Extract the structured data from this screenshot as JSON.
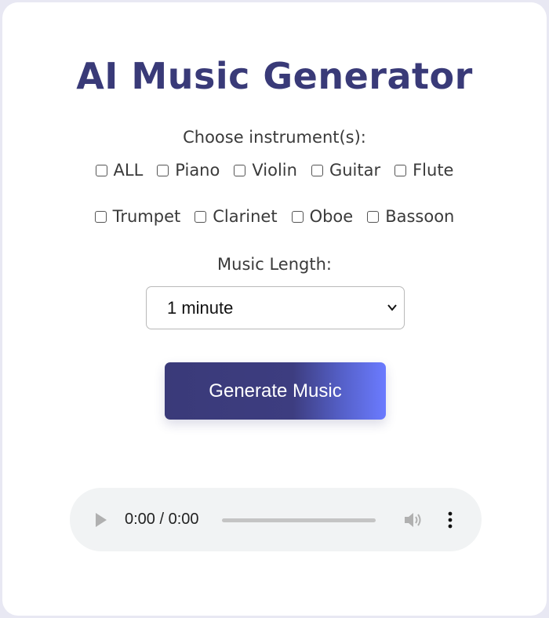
{
  "title": "AI Music Generator",
  "instruments": {
    "label": "Choose instrument(s):",
    "row1": [
      "ALL",
      "Piano",
      "Violin",
      "Guitar",
      "Flute"
    ],
    "row2": [
      "Trumpet",
      "Clarinet",
      "Oboe",
      "Bassoon"
    ]
  },
  "length": {
    "label": "Music Length:",
    "selected": "1 minute"
  },
  "generate_button": "Generate Music",
  "player": {
    "time": "0:00 / 0:00"
  },
  "colors": {
    "title": "#393a78",
    "button_start": "#3a3a79",
    "button_end": "#6b7bff",
    "background": "#e8e8f3"
  }
}
